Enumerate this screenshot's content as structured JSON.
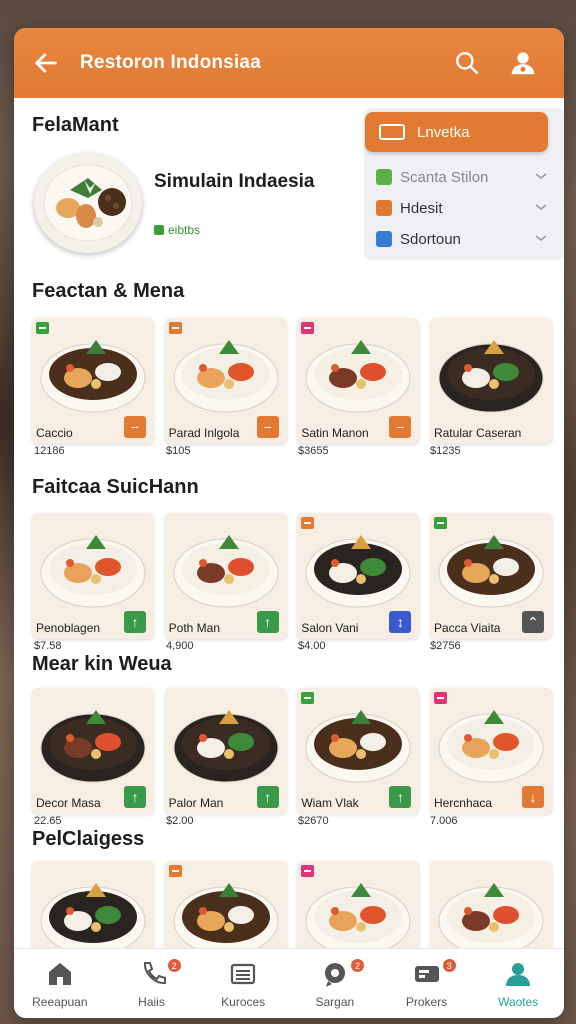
{
  "header": {
    "title": "Restoron Indonsiaa",
    "back_icon": "arrow-left-icon",
    "search_icon": "search-icon",
    "profile_icon": "user-icon"
  },
  "featured": {
    "heading": "FelaMant",
    "name": "Simulain Indaesia",
    "badge": "eibtbs"
  },
  "filters": {
    "primary": "Lnvetka",
    "items": [
      {
        "label": "Scanta Stilon",
        "color": "#5ab04a"
      },
      {
        "label": "Hdesit",
        "color": "#e37a33"
      },
      {
        "label": "Sdortoun",
        "color": "#3a7ad0"
      }
    ]
  },
  "sections": [
    {
      "title": "Feactan & Mena",
      "items": [
        {
          "name": "Caccio",
          "price": "12186",
          "marker": "#3aa03a",
          "action": "−",
          "action_color": "#e37a33"
        },
        {
          "name": "Parad Inlgola",
          "price": "$105",
          "marker": "#e37a33",
          "action": "−",
          "action_color": "#e37a33"
        },
        {
          "name": "Satin Manon",
          "price": "$3655",
          "marker": "#e0337a",
          "action": "−",
          "action_color": "#e37a33"
        },
        {
          "name": "Ratular Caseran",
          "price": "$1235",
          "marker": "",
          "action": "",
          "action_color": ""
        }
      ]
    },
    {
      "title": "Faitcaa SuicHann",
      "items": [
        {
          "name": "Penoblagen",
          "price": "$7.58",
          "marker": "",
          "action": "↑",
          "action_color": "#3a9a4a"
        },
        {
          "name": "Poth Man",
          "price": "4,900",
          "marker": "",
          "action": "↑",
          "action_color": "#3a9a4a"
        },
        {
          "name": "Salon Vani",
          "price": "$4.00",
          "marker": "#e37a33",
          "action": "↕",
          "action_color": "#3a5ad0"
        },
        {
          "name": "Pacca Viaita",
          "price": "$2756",
          "marker": "#3aa03a",
          "action": "⌃",
          "action_color": "#555"
        }
      ]
    },
    {
      "title": "Mear kin Weua",
      "items": [
        {
          "name": "Decor Masa",
          "price": "22.65",
          "marker": "",
          "action": "↑",
          "action_color": "#3a9a4a"
        },
        {
          "name": "Palor Man",
          "price": "$2.00",
          "marker": "",
          "action": "↑",
          "action_color": "#3a9a4a"
        },
        {
          "name": "Wiam Vlak",
          "price": "$2670",
          "marker": "#3aa03a",
          "action": "↑",
          "action_color": "#3a9a4a"
        },
        {
          "name": "Hercnhaca",
          "price": "7.006",
          "marker": "#e0337a",
          "action": "↓",
          "action_color": "#e37a33"
        }
      ]
    },
    {
      "title": "PelClaigess",
      "items": [
        {
          "name": "",
          "price": "",
          "marker": "",
          "action": "",
          "action_color": ""
        },
        {
          "name": "",
          "price": "",
          "marker": "#e37a33",
          "action": "",
          "action_color": ""
        },
        {
          "name": "",
          "price": "",
          "marker": "#e0337a",
          "action": "",
          "action_color": ""
        },
        {
          "name": "",
          "price": "",
          "marker": "",
          "action": "",
          "action_color": ""
        }
      ]
    }
  ],
  "tabs": [
    {
      "label": "Reeapuan",
      "icon": "home-icon",
      "badge": ""
    },
    {
      "label": "Haiis",
      "icon": "phone-icon",
      "badge": "2"
    },
    {
      "label": "Kuroces",
      "icon": "list-icon",
      "badge": ""
    },
    {
      "label": "Sargan",
      "icon": "chat-icon",
      "badge": "2"
    },
    {
      "label": "Prokers",
      "icon": "card-icon",
      "badge": "3"
    },
    {
      "label": "Waotes",
      "icon": "person-icon",
      "badge": ""
    }
  ],
  "colors": {
    "accent": "#e37a33",
    "active_tab": "#2a9d9a"
  }
}
